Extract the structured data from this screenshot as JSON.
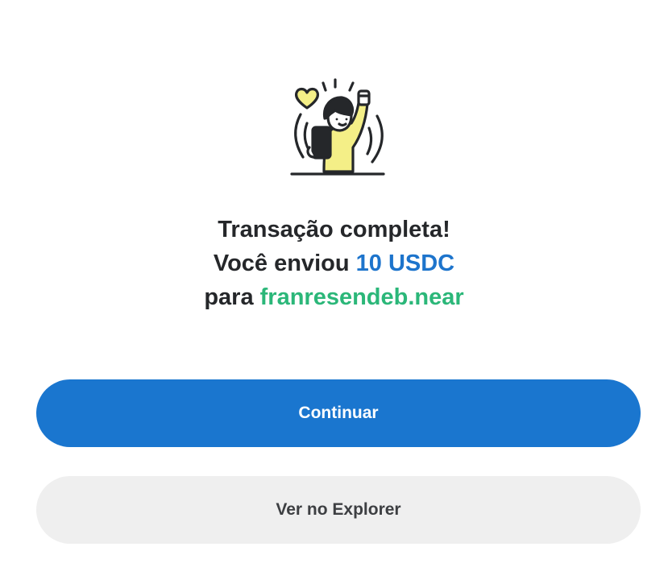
{
  "result": {
    "illustration_icon": "celebrating-person-icon",
    "title": "Transação completa!",
    "sent_prefix": "Você enviou",
    "amount": "10 USDC",
    "recipient_prefix": "para",
    "recipient": "franresendeb.near"
  },
  "actions": {
    "continue_label": "Continuar",
    "explorer_label": "Ver no Explorer"
  },
  "colors": {
    "primary": "#1a76cf",
    "amount": "#1d74cc",
    "recipient": "#2bb779",
    "accent_yellow": "#f4ef87",
    "secondary_bg": "#efefef"
  }
}
